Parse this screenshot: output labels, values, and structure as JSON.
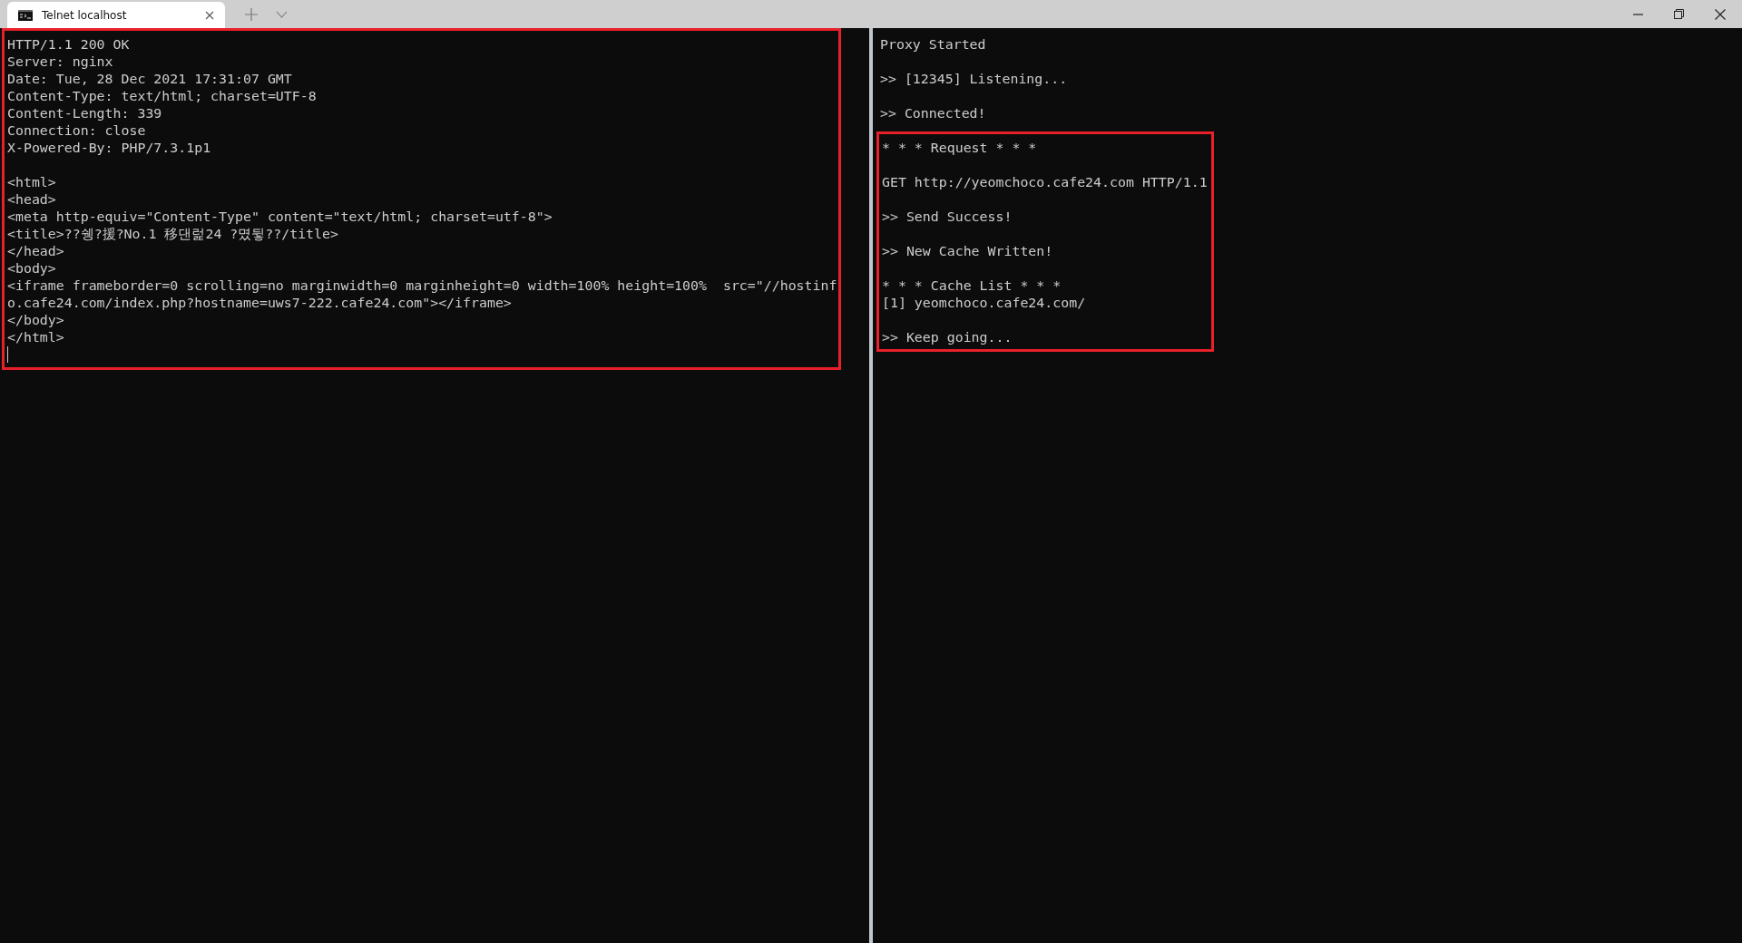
{
  "tabs": [
    {
      "title": "Telnet localhost",
      "selected": true
    }
  ],
  "panes": [
    {
      "cursor": true,
      "sections": [
        {
          "highlighted": true,
          "paragraphs": [
            [
              "HTTP/1.1 200 OK",
              "Server: nginx",
              "Date: Tue, 28 Dec 2021 17:31:07 GMT",
              "Content-Type: text/html; charset=UTF-8",
              "Content-Length: 339",
              "Connection: close",
              "X-Powered-By: PHP/7.3.1p1"
            ],
            [
              "<html>",
              "<head>",
              "<meta http-equiv=\"Content-Type\" content=\"text/html; charset=utf-8\">",
              "<title>??쉥?援?No.1 移댄럹24 ?몄뒿??/title>",
              "</head>",
              "<body>",
              "<iframe frameborder=0 scrolling=no marginwidth=0 marginheight=0 width=100% height=100%  src=\"//hostinf",
              "o.cafe24.com/index.php?hostname=uws7-222.cafe24.com\"></iframe>",
              "</body>",
              "</html>"
            ]
          ]
        }
      ]
    },
    {
      "cursor": false,
      "sections": [
        {
          "highlighted": false,
          "paragraphs": [
            [
              "Proxy Started"
            ],
            [
              ">> [12345] Listening..."
            ],
            [
              ">> Connected!"
            ]
          ]
        },
        {
          "highlighted": true,
          "paragraphs": [
            [
              "* * * Request * * *"
            ],
            [
              "GET http://yeomchoco.cafe24.com HTTP/1.1"
            ],
            [
              ">> Send Success!"
            ],
            [
              ">> New Cache Written!"
            ],
            [
              "* * * Cache List * * *",
              "[1] yeomchoco.cafe24.com/"
            ],
            [
              ">> Keep going..."
            ]
          ]
        }
      ]
    }
  ]
}
